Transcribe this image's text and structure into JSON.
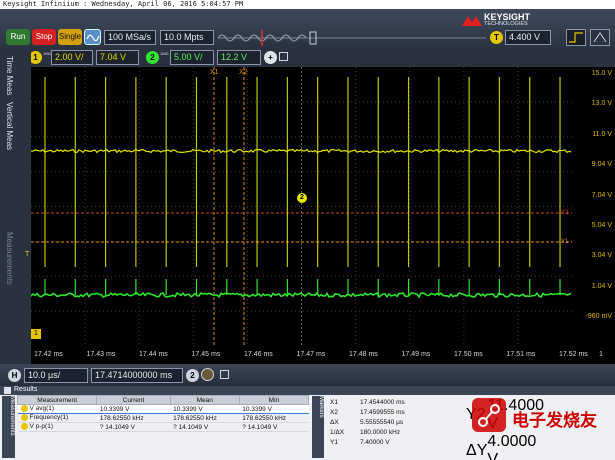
{
  "title_bar": "Keysight Infiniium : Wednesday, April 06, 2016 5:04:57 PM",
  "toolbar": {
    "run": "Run",
    "stop": "Stop",
    "single": "Single",
    "sample_rate": "100 MSa/s",
    "memory_depth": "10.0 Mpts",
    "trigger_chip": "T",
    "trigger_level": "4.400 V"
  },
  "brand": {
    "name": "KEYSIGHT",
    "sub": "TECHNOLOGIES"
  },
  "channels": {
    "ch1_id": "1",
    "ch1_scale": "2.00 V/",
    "ch1_offset": "7.04 V",
    "ch2_id": "2",
    "ch2_scale": "5.00 V/",
    "ch2_offset": "12.2 V",
    "ch_tag": "1MΩ",
    "add_label": "+"
  },
  "left_tabs": [
    "Time Meas",
    "Vertical Meas",
    "Measurements"
  ],
  "y_axis": [
    "15.0 V",
    "13.0 V",
    "11.0 V",
    "9.04 V",
    "7.04 V",
    "5.04 V",
    "3.04 V",
    "1.04 V",
    "-960 mV"
  ],
  "x_axis": [
    "17.42 ms",
    "17.43 ms",
    "17.44 ms",
    "17.45 ms",
    "17.46 ms",
    "17.47 ms",
    "17.48 ms",
    "17.49 ms",
    "17.50 ms",
    "17.51 ms",
    "17.52 ms"
  ],
  "x_corner": "1",
  "markers_on_screen": {
    "x1": "X1",
    "x2": "X2",
    "y1": "Y1",
    "y2": "Y2",
    "t": "T",
    "ch2": "2",
    "gnd": "1"
  },
  "timebase": {
    "h_chip": "H",
    "scale": "10.0 µs/",
    "position": "17.4714000000 ms",
    "zoom": "2"
  },
  "results": {
    "header": "Results",
    "side_tab": "Measurements",
    "markers_tab": "Markers",
    "columns": [
      "Measurement",
      "Current",
      "Mean",
      "Min"
    ],
    "rows": [
      {
        "ch": "1",
        "name": "V avg(1)",
        "current": "10.3399 V",
        "mean": "10.3399 V",
        "min": "10.3399 V",
        "color": "#e6c600"
      },
      {
        "ch": "1",
        "name": "Frequency(1)",
        "current": "178.62550 kHz",
        "mean": "178.62550 kHz",
        "min": "178.62550 kHz",
        "color": "#e6c600"
      },
      {
        "ch": "1",
        "name": "V p-p(1)",
        "current": "? 14.1049 V",
        "mean": "? 14.1049 V",
        "min": "? 14.1049 V",
        "color": "#e6c600"
      }
    ],
    "markers": [
      {
        "k": "X1",
        "v": "17.4544000 ms"
      },
      {
        "k": "X2",
        "v": "17.4599555 ms"
      },
      {
        "k": "ΔX",
        "v": "5.55555540 µs"
      },
      {
        "k": "1/ΔX",
        "v": "180.0000 kHz"
      },
      {
        "k": "Y1",
        "v": "7.40000 V"
      }
    ],
    "ymarkers": [
      {
        "k": "Y2",
        "v": "11.4000 V"
      },
      {
        "k": "ΔY",
        "v": "4.0000 V"
      }
    ]
  },
  "watermark": "电子发烧友",
  "colors": {
    "ch1": "#e6e600",
    "ch2": "#2ee62e",
    "marker_orange": "#e08a1e",
    "marker_red": "#c84a2a",
    "stop": "#d42020",
    "run": "#2f7a2f",
    "single": "#d4a010"
  }
}
